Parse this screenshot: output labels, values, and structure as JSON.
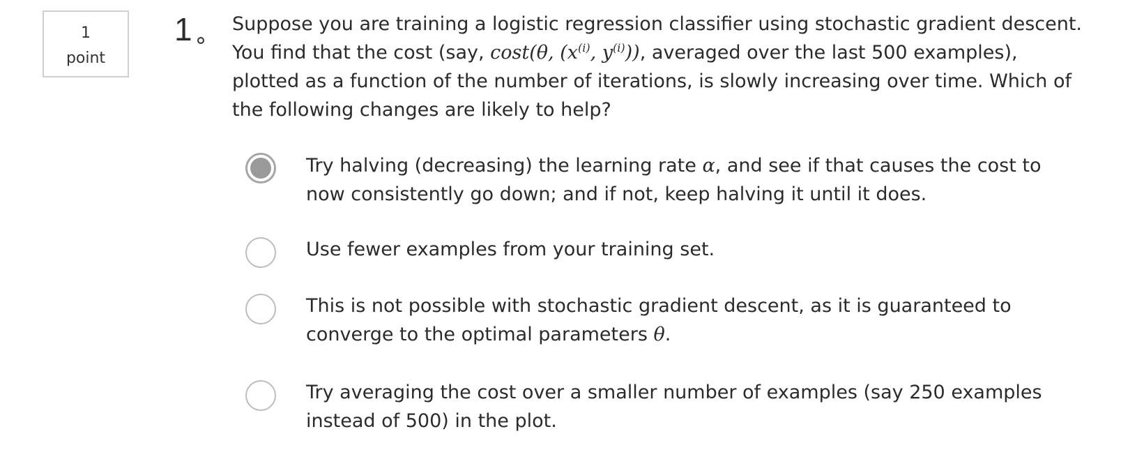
{
  "points": {
    "value": "1",
    "label": "point"
  },
  "question": {
    "number": "1",
    "line1": "Suppose you are training a logistic regression classifier using stochastic gradient descent.",
    "line2_pre": "You find that the cost (say, ",
    "line2_math_a": "cost(θ, (x",
    "line2_sup_1": "(i)",
    "line2_math_b": ", y",
    "line2_sup_2": "(i)",
    "line2_math_c": "))",
    "line2_post": ", averaged over the last 500 examples),",
    "line3": "plotted as a function of the number of iterations, is slowly increasing over time. Which of",
    "line4": "the following changes are likely to help?"
  },
  "options": [
    {
      "selected": true,
      "line1_pre": "Try halving (decreasing) the learning rate ",
      "line1_math": "α",
      "line1_post": ", and see if that causes the cost to",
      "line2": "now consistently go down; and if not, keep halving it until it does."
    },
    {
      "selected": false,
      "line1": "Use fewer examples from your training set."
    },
    {
      "selected": false,
      "line1": "This is not possible with stochastic gradient descent, as it is guaranteed to",
      "line2_pre": "converge to the optimal parameters ",
      "line2_math": "θ",
      "line2_post": "."
    },
    {
      "selected": false,
      "line1": "Try averaging the cost over a smaller number of examples (say 250 examples",
      "line2": "instead of 500) in the plot."
    }
  ]
}
